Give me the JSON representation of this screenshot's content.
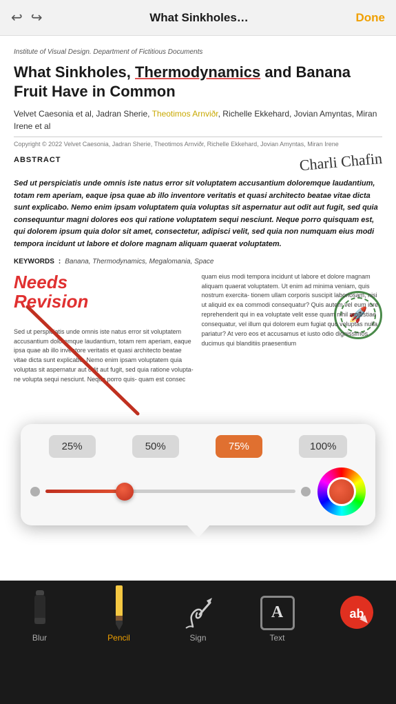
{
  "topBar": {
    "title": "What Sinkholes…",
    "doneLabel": "Done"
  },
  "document": {
    "institute": "Institute of Visual Design. Department of Fictitious Documents",
    "title_part1": "What Sinkholes, ",
    "title_underline": "Thermodynamics",
    "title_part2": " and Banana Fruit Have in Common",
    "authors": "Velvet Caesonia et al, Jadran Sherie, ",
    "author_highlight": "Theotimos Arnviðr",
    "authors_rest": ", Richelle Ekkehard, Jovian Amyntas, Miran Irene et al",
    "copyright": "Copyright © 2022 Velvet Caesonia, Jadran Sherie, Theotimos Arnviðr, Richelle Ekkehard, Jovian Amyntas, Miran Irene",
    "abstractLabel": "ABSTRACT",
    "signature": "Charli Chafin",
    "abstractText": "Sed ut perspiciatis unde omnis iste natus error sit voluptatem accusantium doloremque laudantium, totam rem aperiam, eaque ipsa quae ab illo inventore veritatis et quasi architecto beatae vitae dicta sunt explicabo. Nemo enim ipsam voluptatem quia voluptas sit aspernatur aut odit aut fugit, sed quia consequuntur magni dolores eos qui ratione voluptatem sequi nesciunt. Neque porro quisquam est, qui dolorem ipsum quia dolor sit amet, consectetur, adipisci velit, sed quia non numquam eius modi tempora incidunt ut labore et dolore magnam aliquam quaerat voluptatem.",
    "keywordsLabel": "KEYWORDS",
    "keywords": "Banana, Thermodynamics, Megalomania, Space",
    "bodyLeftText": "Sed ut perspiciatis unde omnis iste natus error sit voluptatem accusantium doloremque laudantium, totam rem aperiam, eaque ipsa quae ab illo inventore veritatis et quasi architecto beatae vitae dicta sunt explicabo. Nemo enim ipsam voluptatem quia voluptas sit aspernatur aut odit aut fugit, sed quia ratione volupta- ne volupta sequi nesciunt. Neque porro quis- quam est consec",
    "bodyRightText": "quam eius modi tempora incidunt ut labore et dolore magnam aliquam quaerat voluptatem. Ut enim ad minima veniam, quis nostrum exercita- tionem ullam corporis suscipit laboriosam, nisi ut aliquid ex ea commodi consequatur? Quis autem vel eum iure reprehenderit qui in ea voluptate velit esse quam nihil molestiae consequatur, vel illum qui dolorem eum fugiat quo voluptas nulla pariatur? At vero eos et accusamus et iusto odio dignissimos ducimus qui blanditiis praesentium",
    "annotation": "Needs Revision",
    "stampEmoji": "🚀"
  },
  "popup": {
    "percentOptions": [
      "25%",
      "50%",
      "75%",
      "100%"
    ],
    "activePercent": "75%",
    "sliderValue": 30
  },
  "toolbar": {
    "tools": [
      {
        "id": "blur",
        "label": "Blur",
        "active": false
      },
      {
        "id": "pencil",
        "label": "Pencil",
        "active": true
      },
      {
        "id": "sign",
        "label": "Sign",
        "active": false
      },
      {
        "id": "text",
        "label": "Text",
        "active": false
      },
      {
        "id": "abnl",
        "label": "",
        "active": false
      }
    ]
  }
}
